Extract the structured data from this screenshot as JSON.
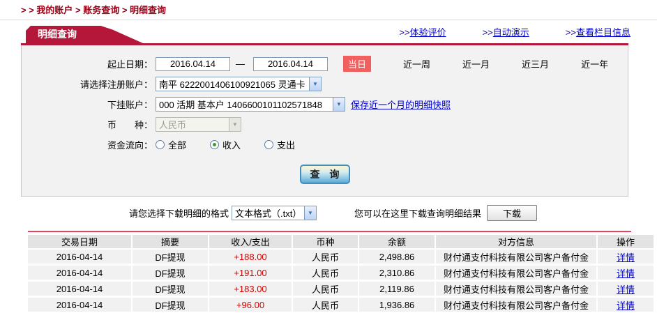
{
  "breadcrumb": {
    "text": "> > 我的账户 > 账务查询 > 明细查询"
  },
  "top_links": [
    {
      "prefix": ">>",
      "label": "体验评价"
    },
    {
      "prefix": ">>",
      "label": "自动演示"
    },
    {
      "prefix": ">>",
      "label": "查看栏目信息"
    }
  ],
  "panel": {
    "tab_title": "明细查询",
    "form": {
      "date_label": "起止日期：",
      "date_from": "2016.04.14",
      "date_sep": "—",
      "date_to": "2016.04.14",
      "quick_ranges": [
        {
          "label": "当日"
        },
        {
          "label": "近一周"
        },
        {
          "label": "近一月"
        },
        {
          "label": "近三月"
        },
        {
          "label": "近一年"
        }
      ],
      "account_label": "请选择注册账户：",
      "account_value": "南平  6222001406100921065  灵通卡",
      "sub_account_label": "下挂账户：",
      "sub_account_value": "000 活期 基本户  1406600101102571848",
      "snapshot_link": "保存近一个月的明细快照",
      "currency_label": "币　　种：",
      "currency_value": "人民币",
      "flow_label": "资金流向：",
      "flow_options": [
        {
          "label": "全部"
        },
        {
          "label": "收入"
        },
        {
          "label": "支出"
        }
      ],
      "query_button": "查 询"
    }
  },
  "download": {
    "format_label": "请您选择下载明细的格式",
    "format_value": "文本格式（.txt）",
    "hint": "您可以在这里下载查询明细结果",
    "button": "下载"
  },
  "table": {
    "headers": [
      "交易日期",
      "摘要",
      "收入/支出",
      "币种",
      "余额",
      "对方信息",
      "操作"
    ],
    "rows": [
      {
        "date": "2016-04-14",
        "summary": "DF提现",
        "amount": "+188.00",
        "currency": "人民币",
        "balance": "2,498.86",
        "counterparty": "财付通支付科技有限公司客户备付金",
        "action": "详情"
      },
      {
        "date": "2016-04-14",
        "summary": "DF提现",
        "amount": "+191.00",
        "currency": "人民币",
        "balance": "2,310.86",
        "counterparty": "财付通支付科技有限公司客户备付金",
        "action": "详情"
      },
      {
        "date": "2016-04-14",
        "summary": "DF提现",
        "amount": "+183.00",
        "currency": "人民币",
        "balance": "2,119.86",
        "counterparty": "财付通支付科技有限公司客户备付金",
        "action": "详情"
      },
      {
        "date": "2016-04-14",
        "summary": "DF提现",
        "amount": "+96.00",
        "currency": "人民币",
        "balance": "1,936.86",
        "counterparty": "财付通支付科技有限公司客户备付金",
        "action": "详情"
      }
    ]
  },
  "colors": {
    "accent_red": "#b4173a",
    "today_red": "#f25f5f",
    "amount_red": "#d40000",
    "link_blue": "#0000cc",
    "table_line_red": "#ee4055"
  }
}
